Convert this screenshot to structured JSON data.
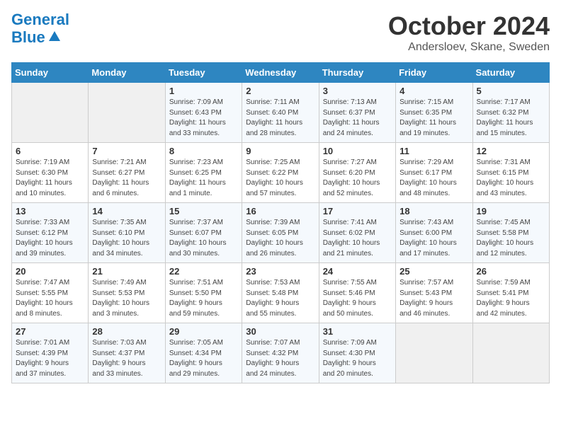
{
  "header": {
    "logo_line1": "General",
    "logo_line2": "Blue",
    "month": "October 2024",
    "location": "Andersloev, Skane, Sweden"
  },
  "days_of_week": [
    "Sunday",
    "Monday",
    "Tuesday",
    "Wednesday",
    "Thursday",
    "Friday",
    "Saturday"
  ],
  "weeks": [
    [
      {
        "day": "",
        "info": ""
      },
      {
        "day": "",
        "info": ""
      },
      {
        "day": "1",
        "info": "Sunrise: 7:09 AM\nSunset: 6:43 PM\nDaylight: 11 hours\nand 33 minutes."
      },
      {
        "day": "2",
        "info": "Sunrise: 7:11 AM\nSunset: 6:40 PM\nDaylight: 11 hours\nand 28 minutes."
      },
      {
        "day": "3",
        "info": "Sunrise: 7:13 AM\nSunset: 6:37 PM\nDaylight: 11 hours\nand 24 minutes."
      },
      {
        "day": "4",
        "info": "Sunrise: 7:15 AM\nSunset: 6:35 PM\nDaylight: 11 hours\nand 19 minutes."
      },
      {
        "day": "5",
        "info": "Sunrise: 7:17 AM\nSunset: 6:32 PM\nDaylight: 11 hours\nand 15 minutes."
      }
    ],
    [
      {
        "day": "6",
        "info": "Sunrise: 7:19 AM\nSunset: 6:30 PM\nDaylight: 11 hours\nand 10 minutes."
      },
      {
        "day": "7",
        "info": "Sunrise: 7:21 AM\nSunset: 6:27 PM\nDaylight: 11 hours\nand 6 minutes."
      },
      {
        "day": "8",
        "info": "Sunrise: 7:23 AM\nSunset: 6:25 PM\nDaylight: 11 hours\nand 1 minute."
      },
      {
        "day": "9",
        "info": "Sunrise: 7:25 AM\nSunset: 6:22 PM\nDaylight: 10 hours\nand 57 minutes."
      },
      {
        "day": "10",
        "info": "Sunrise: 7:27 AM\nSunset: 6:20 PM\nDaylight: 10 hours\nand 52 minutes."
      },
      {
        "day": "11",
        "info": "Sunrise: 7:29 AM\nSunset: 6:17 PM\nDaylight: 10 hours\nand 48 minutes."
      },
      {
        "day": "12",
        "info": "Sunrise: 7:31 AM\nSunset: 6:15 PM\nDaylight: 10 hours\nand 43 minutes."
      }
    ],
    [
      {
        "day": "13",
        "info": "Sunrise: 7:33 AM\nSunset: 6:12 PM\nDaylight: 10 hours\nand 39 minutes."
      },
      {
        "day": "14",
        "info": "Sunrise: 7:35 AM\nSunset: 6:10 PM\nDaylight: 10 hours\nand 34 minutes."
      },
      {
        "day": "15",
        "info": "Sunrise: 7:37 AM\nSunset: 6:07 PM\nDaylight: 10 hours\nand 30 minutes."
      },
      {
        "day": "16",
        "info": "Sunrise: 7:39 AM\nSunset: 6:05 PM\nDaylight: 10 hours\nand 26 minutes."
      },
      {
        "day": "17",
        "info": "Sunrise: 7:41 AM\nSunset: 6:02 PM\nDaylight: 10 hours\nand 21 minutes."
      },
      {
        "day": "18",
        "info": "Sunrise: 7:43 AM\nSunset: 6:00 PM\nDaylight: 10 hours\nand 17 minutes."
      },
      {
        "day": "19",
        "info": "Sunrise: 7:45 AM\nSunset: 5:58 PM\nDaylight: 10 hours\nand 12 minutes."
      }
    ],
    [
      {
        "day": "20",
        "info": "Sunrise: 7:47 AM\nSunset: 5:55 PM\nDaylight: 10 hours\nand 8 minutes."
      },
      {
        "day": "21",
        "info": "Sunrise: 7:49 AM\nSunset: 5:53 PM\nDaylight: 10 hours\nand 3 minutes."
      },
      {
        "day": "22",
        "info": "Sunrise: 7:51 AM\nSunset: 5:50 PM\nDaylight: 9 hours\nand 59 minutes."
      },
      {
        "day": "23",
        "info": "Sunrise: 7:53 AM\nSunset: 5:48 PM\nDaylight: 9 hours\nand 55 minutes."
      },
      {
        "day": "24",
        "info": "Sunrise: 7:55 AM\nSunset: 5:46 PM\nDaylight: 9 hours\nand 50 minutes."
      },
      {
        "day": "25",
        "info": "Sunrise: 7:57 AM\nSunset: 5:43 PM\nDaylight: 9 hours\nand 46 minutes."
      },
      {
        "day": "26",
        "info": "Sunrise: 7:59 AM\nSunset: 5:41 PM\nDaylight: 9 hours\nand 42 minutes."
      }
    ],
    [
      {
        "day": "27",
        "info": "Sunrise: 7:01 AM\nSunset: 4:39 PM\nDaylight: 9 hours\nand 37 minutes."
      },
      {
        "day": "28",
        "info": "Sunrise: 7:03 AM\nSunset: 4:37 PM\nDaylight: 9 hours\nand 33 minutes."
      },
      {
        "day": "29",
        "info": "Sunrise: 7:05 AM\nSunset: 4:34 PM\nDaylight: 9 hours\nand 29 minutes."
      },
      {
        "day": "30",
        "info": "Sunrise: 7:07 AM\nSunset: 4:32 PM\nDaylight: 9 hours\nand 24 minutes."
      },
      {
        "day": "31",
        "info": "Sunrise: 7:09 AM\nSunset: 4:30 PM\nDaylight: 9 hours\nand 20 minutes."
      },
      {
        "day": "",
        "info": ""
      },
      {
        "day": "",
        "info": ""
      }
    ]
  ]
}
